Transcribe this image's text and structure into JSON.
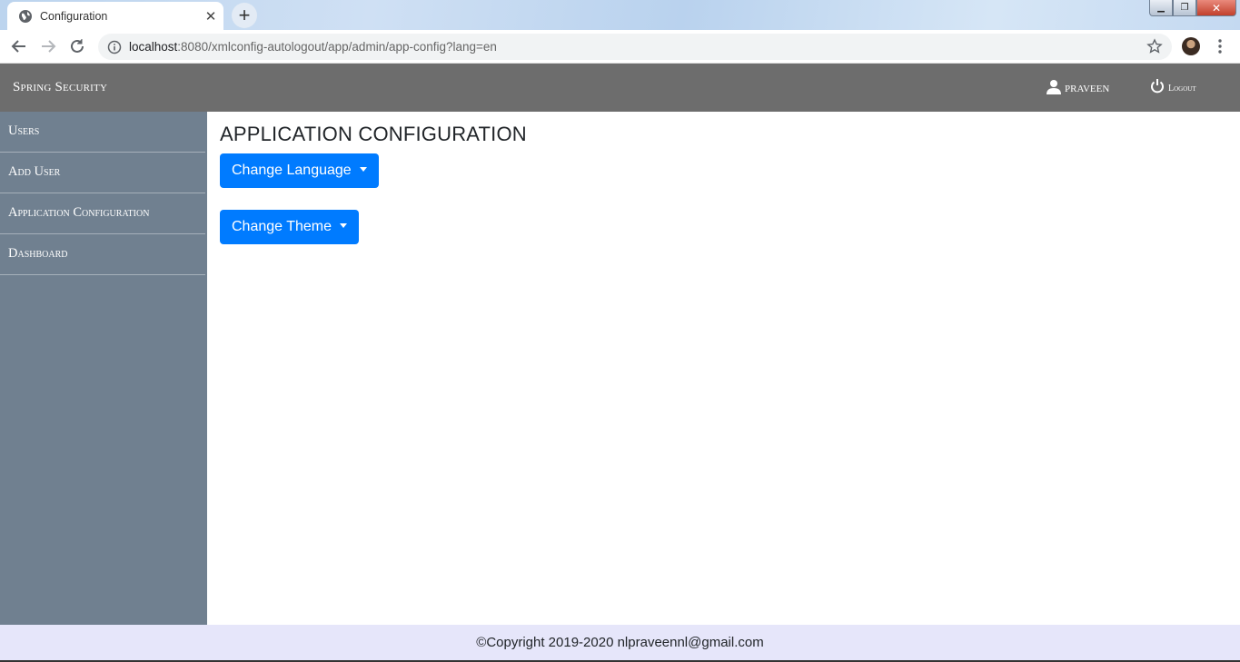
{
  "browser": {
    "tab_title": "Configuration",
    "url_host": "localhost",
    "url_rest": ":8080/xmlconfig-autologout/app/admin/app-config?lang=en"
  },
  "header": {
    "brand": "Spring Security",
    "user_name": "PRAVEEN",
    "logout_label": "Logout"
  },
  "sidebar": {
    "items": [
      {
        "label": "Users"
      },
      {
        "label": "Add User"
      },
      {
        "label": "Application Configuration"
      },
      {
        "label": "Dashboard"
      }
    ]
  },
  "main": {
    "title": "APPLICATION CONFIGURATION",
    "change_language_label": "Change Language",
    "change_theme_label": "Change Theme"
  },
  "footer": {
    "copyright": "©Copyright 2019-2020 nlpraveennl@gmail.com"
  },
  "colors": {
    "header_bg": "#6d6d6d",
    "sidebar_bg": "#708090",
    "button_primary": "#007bff",
    "footer_bg": "#e6e6fa"
  }
}
